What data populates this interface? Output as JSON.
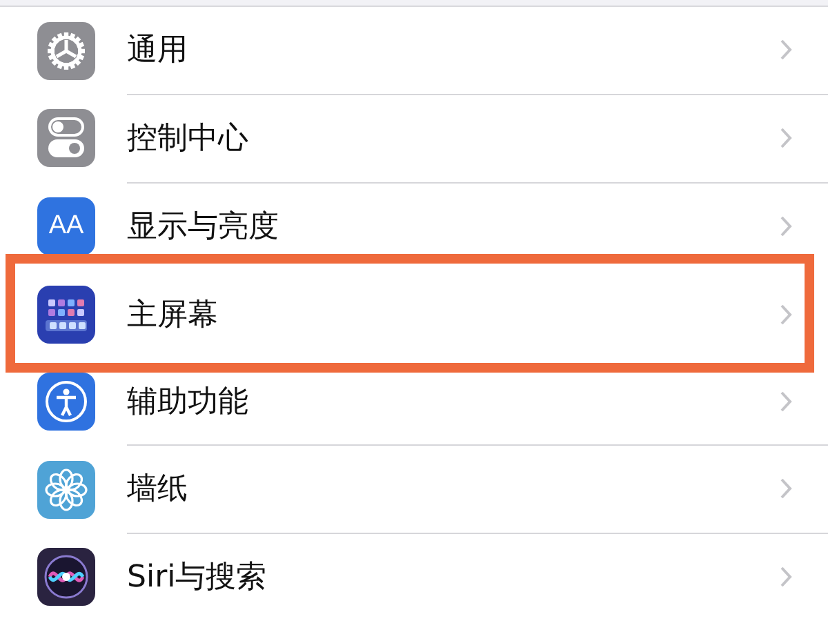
{
  "settings": [
    {
      "label": "通用",
      "kind": "gear",
      "highlighted": false
    },
    {
      "label": "控制中心",
      "kind": "toggles",
      "highlighted": false
    },
    {
      "label": "显示与亮度",
      "kind": "letters",
      "icon_text": "AA",
      "highlighted": false
    },
    {
      "label": "主屏幕",
      "kind": "grid",
      "highlighted": true
    },
    {
      "label": "辅助功能",
      "kind": "accessibility",
      "highlighted": false
    },
    {
      "label": "墙纸",
      "kind": "flower",
      "highlighted": false
    },
    {
      "label": "Siri与搜索",
      "kind": "siri",
      "highlighted": false
    }
  ]
}
